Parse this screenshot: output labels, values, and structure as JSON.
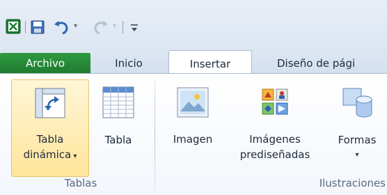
{
  "quick_access": {
    "icons": [
      "excel-logo-icon",
      "save-icon",
      "undo-icon",
      "redo-icon",
      "customize-qat-icon"
    ],
    "dropdown_glyph": "▾"
  },
  "tabs": [
    {
      "label": "Archivo",
      "id": "file"
    },
    {
      "label": "Inicio",
      "id": "home"
    },
    {
      "label": "Insertar",
      "id": "insert",
      "active": true
    },
    {
      "label": "Diseño de pági",
      "id": "page-layout"
    }
  ],
  "groups": [
    {
      "label": "Tablas",
      "buttons": [
        {
          "line1": "Tabla",
          "line2": "dinámica",
          "has_dropdown": true,
          "icon": "pivot-table-icon",
          "selected": true
        },
        {
          "line1": "Tabla",
          "line2": "",
          "has_dropdown": false,
          "icon": "table-icon"
        }
      ]
    },
    {
      "label": "Ilustraciones",
      "buttons": [
        {
          "line1": "Imagen",
          "line2": "",
          "icon": "picture-icon"
        },
        {
          "line1": "Imágenes",
          "line2": "prediseñadas",
          "icon": "clip-art-icon"
        },
        {
          "line1": "Formas",
          "line2": "",
          "has_dropdown": true,
          "icon": "shapes-icon"
        }
      ]
    }
  ],
  "colors": {
    "file_tab": "#1f7a30",
    "selected_button": "#ffe59a",
    "ribbon_bg": "#ffffff"
  }
}
